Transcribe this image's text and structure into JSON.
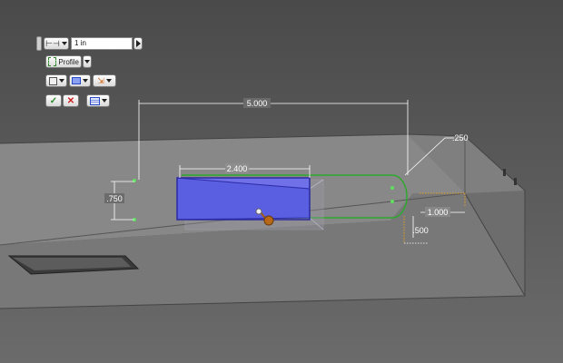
{
  "toolbar": {
    "distance_value": "1 in",
    "profile_label": "Profile",
    "icons": [
      "dimension-type-icon",
      "profile-select-icon",
      "extents-icon",
      "direction-icon",
      "flip-icon",
      "ok-check-icon",
      "cancel-x-icon",
      "options-icon"
    ]
  },
  "dimensions": {
    "overall_length": "5.000",
    "slot_length": "2.400",
    "offset_height": ".750",
    "end_radius": ".250",
    "end_offset": "1.000",
    "vertical_offset": ".500"
  },
  "colors": {
    "part_face": "#8a8a8a",
    "preview_face": "#5a5ee0",
    "sketch_curve": "#2ea82e",
    "dimension_line": "#ffffff"
  }
}
